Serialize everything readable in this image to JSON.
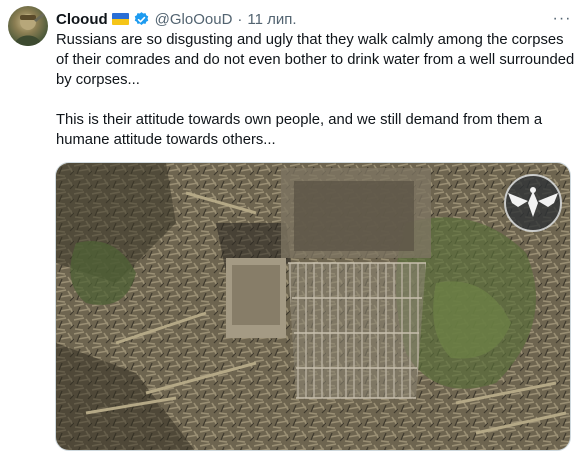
{
  "tweet": {
    "display_name": "Clooud",
    "handle": "@GloOouD",
    "separator": "·",
    "time": "11 лип.",
    "paragraphs": [
      "Russians are so disgusting and ugly that they walk calmly among the corpses of their comrades and do not even bother to drink water from a well surrounded by corpses...",
      "This is their attitude towards own people, and we still demand from them a humane attitude towards others..."
    ],
    "more_glyph": "···"
  },
  "icons": {
    "flag": "ukraine-flag-icon",
    "verified": "verified-badge-icon",
    "more": "more-options-icon",
    "watermark": "eagle-emblem-icon"
  },
  "colors": {
    "verified_blue": "#1d9bf0",
    "flag_blue": "#2a6fd6",
    "flag_yellow": "#f5c518",
    "secondary_text": "#536471"
  }
}
